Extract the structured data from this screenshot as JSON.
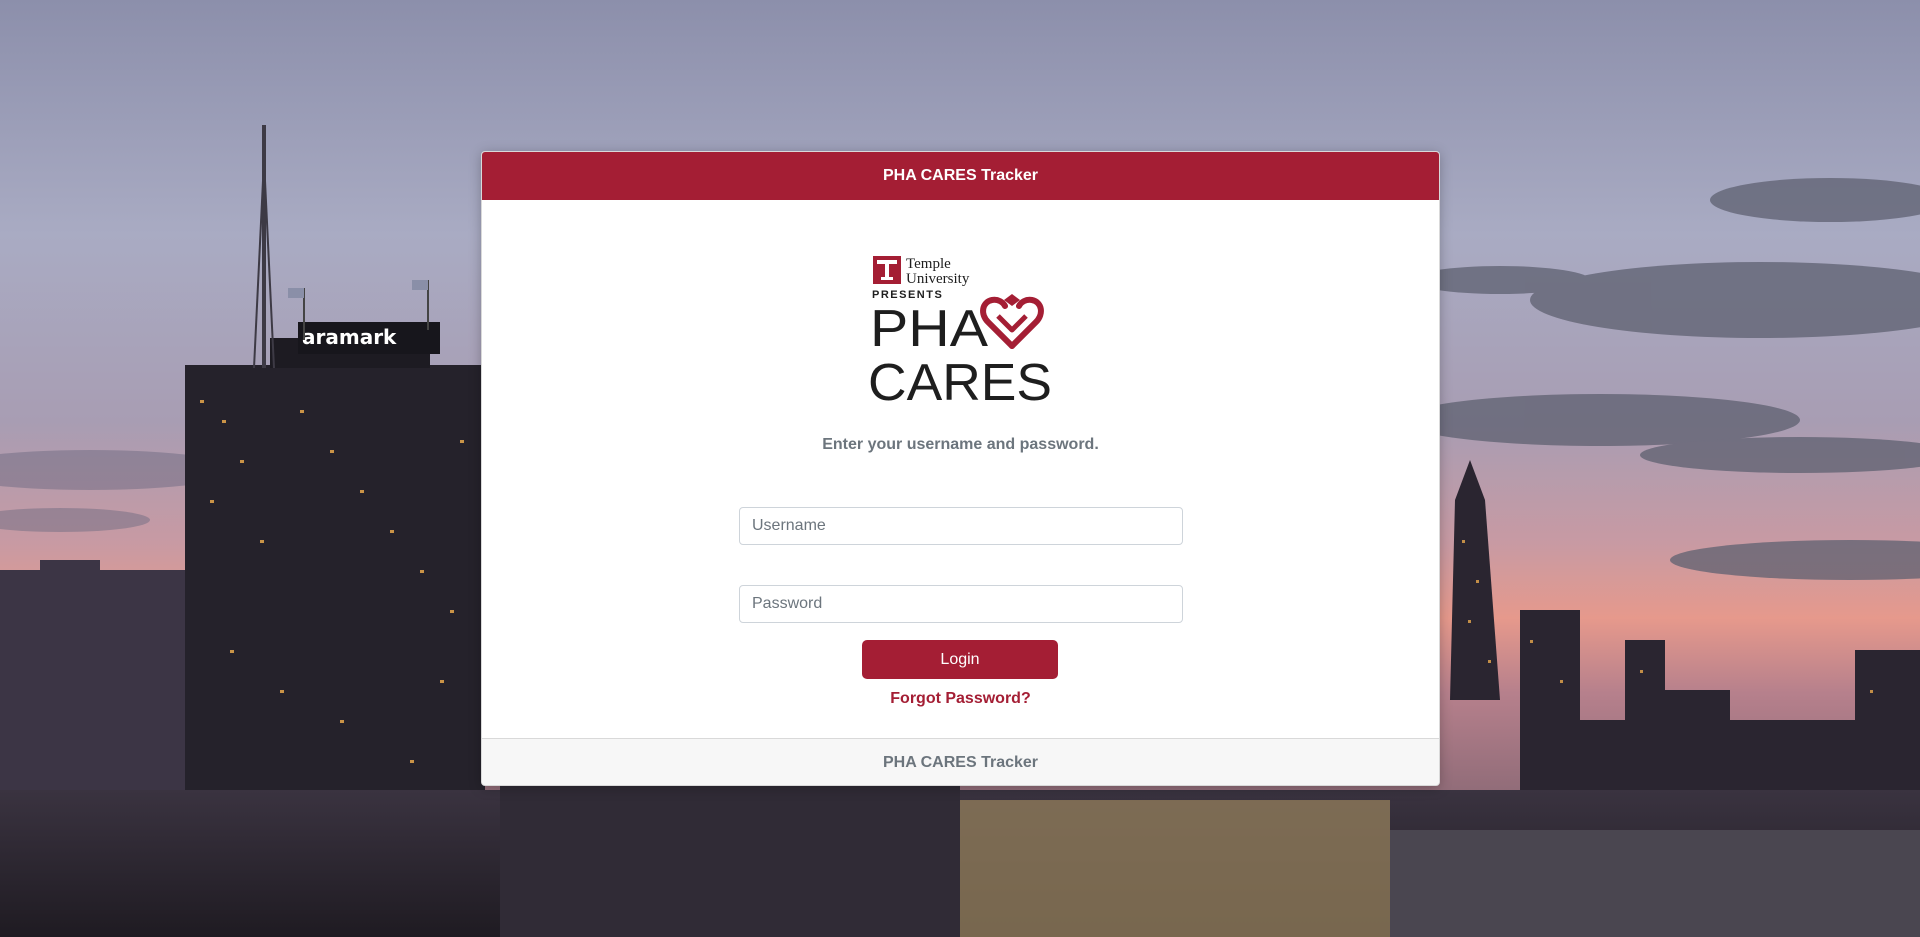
{
  "header": {
    "title": "PHA CARES Tracker"
  },
  "logo": {
    "university": [
      "Temple",
      "University"
    ],
    "presents": "PRESENTS",
    "line1": "PHA",
    "line2": "CARES"
  },
  "background": {
    "building_sign": "aramark"
  },
  "form": {
    "instructions": "Enter your username and password.",
    "username_placeholder": "Username",
    "username_value": "",
    "password_placeholder": "Password",
    "password_value": "",
    "login_label": "Login",
    "forgot_label": "Forgot Password?"
  },
  "footer": {
    "text": "PHA CARES Tracker"
  },
  "colors": {
    "brand": "#a41e34",
    "muted_text": "#6c757d",
    "footer_bg": "#f7f7f7"
  }
}
